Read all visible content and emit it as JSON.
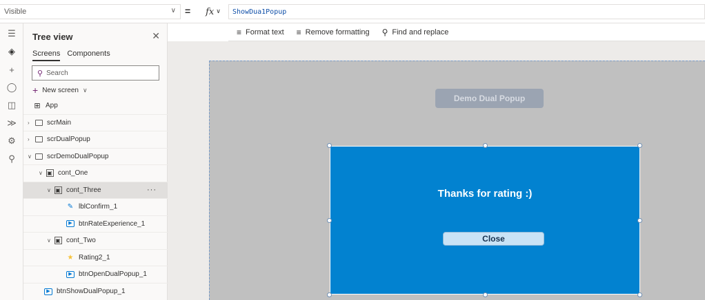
{
  "formula_bar": {
    "property": "Visible",
    "formula": "ShowDua1Popup",
    "equals": "=",
    "fx": "fx"
  },
  "format_toolbar": {
    "format_text": "Format text",
    "remove_formatting": "Remove formatting",
    "find_replace": "Find and replace"
  },
  "tree_view": {
    "title": "Tree view",
    "tabs": [
      "Screens",
      "Components"
    ],
    "search_placeholder": "Search",
    "new_screen": "New screen",
    "items": [
      {
        "label": "App",
        "type": "app"
      },
      {
        "label": "scrMain",
        "type": "screen"
      },
      {
        "label": "scrDualPopup",
        "type": "screen"
      },
      {
        "label": "scrDemoDualPopup",
        "type": "screen"
      },
      {
        "label": "cont_One",
        "type": "container"
      },
      {
        "label": "cont_Three",
        "type": "container",
        "selected": true
      },
      {
        "label": "lblConfirm_1",
        "type": "label"
      },
      {
        "label": "btnRateExperience_1",
        "type": "button"
      },
      {
        "label": "cont_Two",
        "type": "container"
      },
      {
        "label": "Rating2_1",
        "type": "rating"
      },
      {
        "label": "btnOpenDualPopup_1",
        "type": "button"
      },
      {
        "label": "btnShowDualPopup_1",
        "type": "button"
      }
    ]
  },
  "canvas": {
    "demo_button": "Demo Dual Popup",
    "popup_message": "Thanks for rating :)",
    "close_button": "Close"
  },
  "colors": {
    "popup": "#0282d0",
    "accent": "#742774",
    "screen_bg": "#c0c0c0"
  }
}
